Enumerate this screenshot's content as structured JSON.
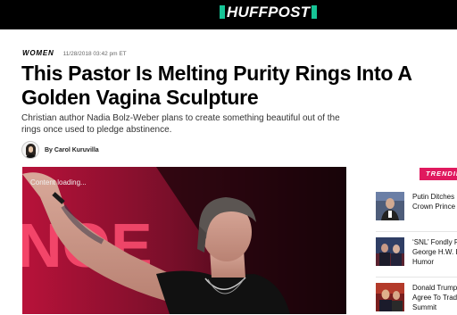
{
  "site": {
    "logo_text": "HUFFPOST",
    "brand_color": "#16c496"
  },
  "article": {
    "section": "WOMEN",
    "timestamp": "11/28/2018 03:42 pm ET",
    "headline": "This Pastor Is Melting Purity Rings Into A Golden Vagina Sculpture",
    "dek": "Christian author Nadia Bolz-Weber plans to create something beautiful out of the rings once used to pledge abstinence.",
    "byline": "By Carol Kuruvilla",
    "hero": {
      "status_text": "Content loading...",
      "backdrop_text": "NOE"
    }
  },
  "trending": {
    "label": "TRENDIN",
    "accent_color": "#e0195e",
    "items": [
      {
        "line1": "Putin Ditches",
        "line2": "Crown Prince"
      },
      {
        "line1": "‘SNL’ Fondly R",
        "line2": "George H.W. B",
        "line3": "Humor"
      },
      {
        "line1": "Donald Trump",
        "line2": "Agree To Trad",
        "line3": "Summit"
      }
    ]
  }
}
